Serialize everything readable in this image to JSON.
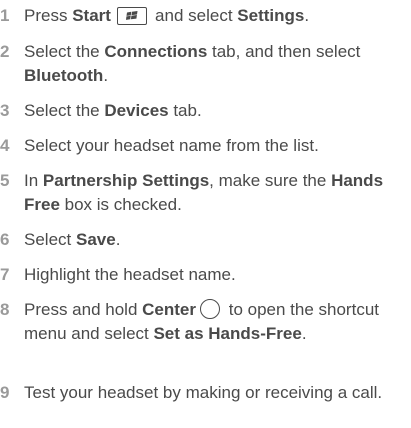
{
  "steps": [
    {
      "number": "1",
      "a": "Press ",
      "b1": "Start",
      "c": " and select ",
      "b2": "Settings",
      "d": ".",
      "icon": "windows-start-icon"
    },
    {
      "number": "2",
      "a": "Select the ",
      "b1": "Connections",
      "c": " tab, and then select ",
      "b2": "Bluetooth",
      "d": "."
    },
    {
      "number": "3",
      "a": "Select the ",
      "b1": "Devices",
      "c": " tab."
    },
    {
      "number": "4",
      "a": "Select your headset name from the list."
    },
    {
      "number": "5",
      "a": "In ",
      "b1": "Partnership Settings",
      "c": ", make sure the ",
      "b2": "Hands Free",
      "d": " box is checked."
    },
    {
      "number": "6",
      "a": "Select ",
      "b1": "Save",
      "c": "."
    },
    {
      "number": "7",
      "a": "Highlight the headset name."
    },
    {
      "number": "8",
      "a": "Press and hold ",
      "b1": "Center",
      "c": " to open the shortcut menu and select ",
      "b2": "Set as Hands-Free",
      "d": ".",
      "icon": "center-button-icon"
    },
    {
      "number": "9",
      "a": "Test your headset by making or receiving a call."
    }
  ]
}
